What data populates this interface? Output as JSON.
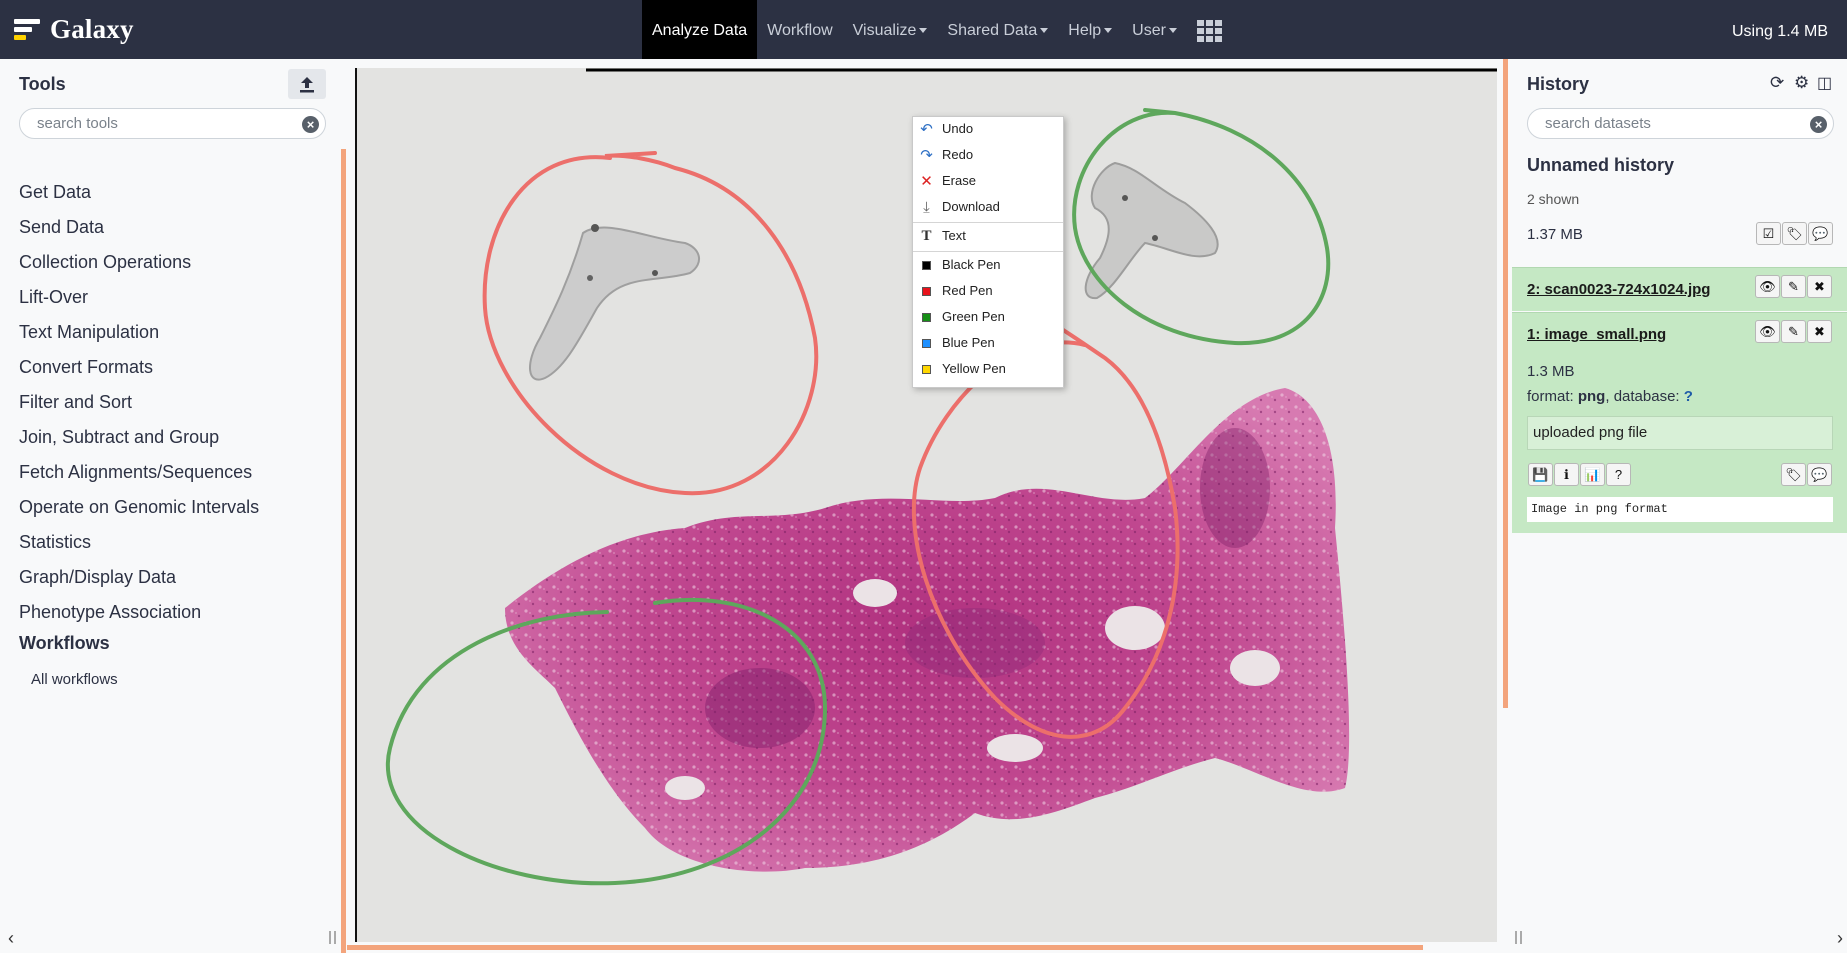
{
  "masthead": {
    "brand": "Galaxy",
    "nav": [
      {
        "label": "Analyze Data",
        "active": true,
        "dropdown": false
      },
      {
        "label": "Workflow",
        "active": false,
        "dropdown": false
      },
      {
        "label": "Visualize",
        "active": false,
        "dropdown": true
      },
      {
        "label": "Shared Data",
        "active": false,
        "dropdown": true
      },
      {
        "label": "Help",
        "active": false,
        "dropdown": true
      },
      {
        "label": "User",
        "active": false,
        "dropdown": true
      }
    ],
    "quota": "Using 1.4 MB"
  },
  "tools": {
    "title": "Tools",
    "search_placeholder": "search tools",
    "sections": [
      "Get Data",
      "Send Data",
      "Collection Operations",
      "Lift-Over",
      "Text Manipulation",
      "Convert Formats",
      "Filter and Sort",
      "Join, Subtract and Group",
      "Fetch Alignments/Sequences",
      "Operate on Genomic Intervals",
      "Statistics",
      "Graph/Display Data",
      "Phenotype Association"
    ],
    "workflows_title": "Workflows",
    "all_workflows": "All workflows"
  },
  "context_menu": {
    "items": [
      {
        "label": "Undo",
        "icon": "undo-icon"
      },
      {
        "label": "Redo",
        "icon": "redo-icon"
      },
      {
        "label": "Erase",
        "icon": "erase-icon"
      },
      {
        "label": "Download",
        "icon": "download-icon"
      },
      {
        "label": "Text",
        "icon": "text-icon"
      },
      {
        "label": "Black Pen",
        "color": "#000000"
      },
      {
        "label": "Red Pen",
        "color": "#e8121b"
      },
      {
        "label": "Green Pen",
        "color": "#168f16"
      },
      {
        "label": "Blue Pen",
        "color": "#1e90ff"
      },
      {
        "label": "Yellow Pen",
        "color": "#ffd700"
      }
    ]
  },
  "history": {
    "title": "History",
    "search_placeholder": "search datasets",
    "name": "Unnamed history",
    "shown": "2 shown",
    "size": "1.37 MB",
    "datasets": [
      {
        "title": "2: scan0023-724x1024.jpg",
        "expanded": false
      },
      {
        "title": "1: image_small.png",
        "expanded": true,
        "size": "1.3 MB",
        "format_label": "format:",
        "format": "png",
        "database_label": ", database:",
        "database": "?",
        "info": "uploaded png file",
        "peek": "Image in png format"
      }
    ]
  },
  "colors": {
    "masthead": "#2c3143",
    "dataset_ok": "#c5e8c4",
    "drag_handle": "#f3a47c",
    "annotation_red": "#ec6f6b",
    "annotation_green": "#5ea75c"
  }
}
